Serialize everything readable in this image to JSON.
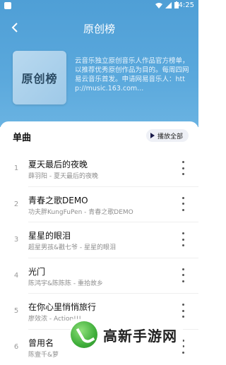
{
  "status_bar": {
    "time": "4:25"
  },
  "header": {
    "back_icon": "back-arrow-icon",
    "title": "原创榜"
  },
  "cover": {
    "label": "原创榜"
  },
  "description": "云音乐独立原创音乐人作品官方榜单，以推荐优秀原创作品为目的。每周四网易云音乐首发。申请网易音乐人：http://music.163.com...",
  "section": {
    "title": "单曲",
    "play_all_label": "播放全部"
  },
  "songs": [
    {
      "num": "1",
      "title": "夏天最后的夜晚",
      "subtitle": "薛羽阳 - 夏天最后的夜晚"
    },
    {
      "num": "2",
      "title": "青春之歌DEMO",
      "subtitle": "功夫胖KungFuPen - 青春之歌DEMO"
    },
    {
      "num": "3",
      "title": "星星的眼泪",
      "subtitle": "超星男孩&戳七爷 - 星星的眼泪"
    },
    {
      "num": "4",
      "title": "光门",
      "subtitle": "陈鸿宇&陈陈陈 - 重拾故乡"
    },
    {
      "num": "5",
      "title": "在你心里悄悄旅行",
      "subtitle": "廖效浓 - Action!!!"
    },
    {
      "num": "6",
      "title": "曾用名",
      "subtitle": "陈壹千&萝"
    }
  ],
  "watermark": {
    "text": "高新手游网"
  },
  "colors": {
    "header_blue": "#5aa8dc",
    "accent_dark": "#1b1b4a"
  }
}
